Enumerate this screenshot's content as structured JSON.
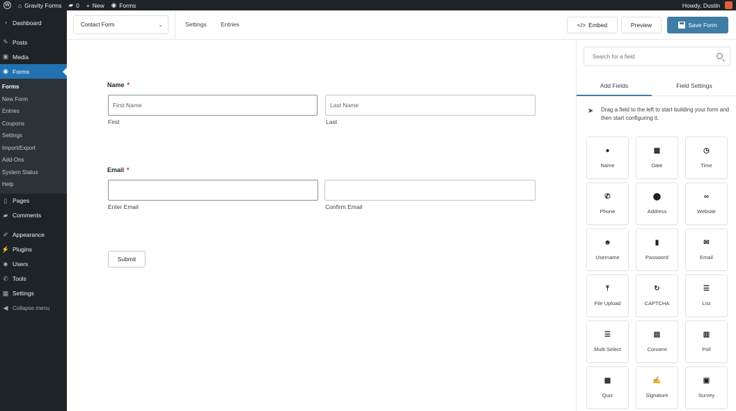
{
  "adminbar": {
    "site": "Gravity Forms",
    "comments": "0",
    "new": "New",
    "forms": "Forms",
    "howdy": "Howdy, Dustin"
  },
  "sidebar": {
    "items": [
      {
        "label": "Dashboard",
        "icon": "dashboard-icon"
      },
      {
        "label": "Posts",
        "icon": "pin-icon"
      },
      {
        "label": "Media",
        "icon": "media-icon"
      },
      {
        "label": "Forms",
        "icon": "forms-icon"
      }
    ],
    "submenu": [
      "Forms",
      "New Form",
      "Entries",
      "Coupons",
      "Settings",
      "Import/Export",
      "Add-Ons",
      "System Status",
      "Help"
    ],
    "items2": [
      {
        "label": "Pages",
        "icon": "pages-icon"
      },
      {
        "label": "Comments",
        "icon": "comments-icon"
      }
    ],
    "items3": [
      {
        "label": "Appearance",
        "icon": "brush-icon"
      },
      {
        "label": "Plugins",
        "icon": "plugin-icon"
      },
      {
        "label": "Users",
        "icon": "users-icon"
      },
      {
        "label": "Tools",
        "icon": "wrench-icon"
      },
      {
        "label": "Settings",
        "icon": "settings-icon"
      }
    ],
    "collapse": "Collapse menu"
  },
  "topbar": {
    "form_name": "Contact Form",
    "settings": "Settings",
    "entries": "Entries",
    "embed": "Embed",
    "embed_glyph": "</>",
    "preview": "Preview",
    "save": "Save Form"
  },
  "form": {
    "name_label": "Name",
    "required_mark": "*",
    "first_placeholder": "First Name",
    "last_placeholder": "Last Name",
    "first_sub": "First",
    "last_sub": "Last",
    "email_label": "Email",
    "enter_email": "Enter Email",
    "confirm_email": "Confirm Email",
    "submit": "Submit"
  },
  "panel": {
    "search_placeholder": "Search for a field",
    "tab_add": "Add Fields",
    "tab_settings": "Field Settings",
    "hint": "Drag a field to the left to start building your form and then start configuring it.",
    "fields": [
      {
        "label": "Name",
        "icon": "user-icon",
        "glyph": "●"
      },
      {
        "label": "Date",
        "icon": "calendar-icon",
        "glyph": "▦"
      },
      {
        "label": "Time",
        "icon": "clock-icon",
        "glyph": "◷"
      },
      {
        "label": "Phone",
        "icon": "phone-icon",
        "glyph": "✆"
      },
      {
        "label": "Address",
        "icon": "location-pin-icon",
        "glyph": "⬤"
      },
      {
        "label": "Website",
        "icon": "link-icon",
        "glyph": "∞"
      },
      {
        "label": "Username",
        "icon": "user-check-icon",
        "glyph": "☻"
      },
      {
        "label": "Password",
        "icon": "lock-icon",
        "glyph": "▮"
      },
      {
        "label": "Email",
        "icon": "envelope-icon",
        "glyph": "✉"
      },
      {
        "label": "File Upload",
        "icon": "upload-icon",
        "glyph": "⤒"
      },
      {
        "label": "CAPTCHA",
        "icon": "captcha-icon",
        "glyph": "↻"
      },
      {
        "label": "List",
        "icon": "list-icon",
        "glyph": "☰"
      },
      {
        "label": "Multi Select",
        "icon": "multi-select-icon",
        "glyph": "☰"
      },
      {
        "label": "Consent",
        "icon": "document-icon",
        "glyph": "▤"
      },
      {
        "label": "Poll",
        "icon": "poll-chart-icon",
        "glyph": "▥"
      },
      {
        "label": "Quiz",
        "icon": "quiz-icon",
        "glyph": "▩"
      },
      {
        "label": "Signature",
        "icon": "signature-icon",
        "glyph": "✍"
      },
      {
        "label": "Survey",
        "icon": "clipboard-icon",
        "glyph": "▣"
      }
    ]
  }
}
